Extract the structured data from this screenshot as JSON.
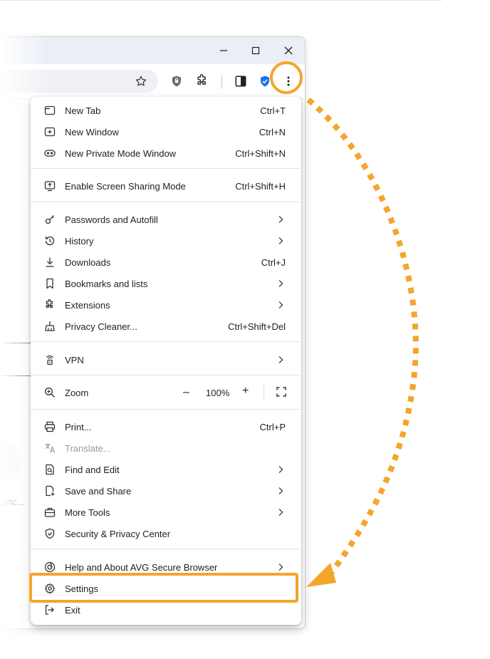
{
  "menu": {
    "group1": [
      {
        "icon": "new-tab-icon",
        "label": "New Tab",
        "shortcut": "Ctrl+T"
      },
      {
        "icon": "new-window-icon",
        "label": "New Window",
        "shortcut": "Ctrl+N"
      },
      {
        "icon": "private-mode-icon",
        "label": "New Private Mode Window",
        "shortcut": "Ctrl+Shift+N"
      }
    ],
    "group2": [
      {
        "icon": "screen-share-icon",
        "label": "Enable Screen Sharing Mode",
        "shortcut": "Ctrl+Shift+H"
      }
    ],
    "group3": [
      {
        "icon": "key-icon",
        "label": "Passwords and Autofill",
        "shortcut": ""
      },
      {
        "icon": "history-icon",
        "label": "History",
        "shortcut": ""
      },
      {
        "icon": "download-icon",
        "label": "Downloads",
        "shortcut": "Ctrl+J"
      },
      {
        "icon": "bookmark-icon",
        "label": "Bookmarks and lists",
        "shortcut": ""
      },
      {
        "icon": "extensions-icon",
        "label": "Extensions",
        "shortcut": ""
      },
      {
        "icon": "broom-icon",
        "label": "Privacy Cleaner...",
        "shortcut": "Ctrl+Shift+Del"
      }
    ],
    "group4": [
      {
        "icon": "vpn-icon",
        "label": "VPN",
        "shortcut": ""
      }
    ],
    "zoom": {
      "icon": "zoom-icon",
      "label": "Zoom",
      "minus": "–",
      "value": "100%",
      "plus": "+"
    },
    "group6": [
      {
        "icon": "print-icon",
        "label": "Print...",
        "shortcut": "Ctrl+P"
      },
      {
        "icon": "translate-icon",
        "label": "Translate...",
        "shortcut": ""
      },
      {
        "icon": "find-icon",
        "label": "Find and Edit",
        "shortcut": ""
      },
      {
        "icon": "save-share-icon",
        "label": "Save and Share",
        "shortcut": ""
      },
      {
        "icon": "toolbox-icon",
        "label": "More Tools",
        "shortcut": ""
      },
      {
        "icon": "shield-check-icon",
        "label": "Security & Privacy Center",
        "shortcut": ""
      }
    ],
    "group7": [
      {
        "icon": "avg-logo-icon",
        "label": "Help and About AVG Secure Browser",
        "shortcut": ""
      },
      {
        "icon": "gear-icon",
        "label": "Settings",
        "shortcut": ""
      },
      {
        "icon": "exit-icon",
        "label": "Exit",
        "shortcut": ""
      }
    ]
  },
  "page": {
    "partial_text": "ortc..."
  },
  "colors": {
    "accent": "#f4a52b",
    "shield_blue": "#1a73e8",
    "text": "#1f1f1f"
  }
}
